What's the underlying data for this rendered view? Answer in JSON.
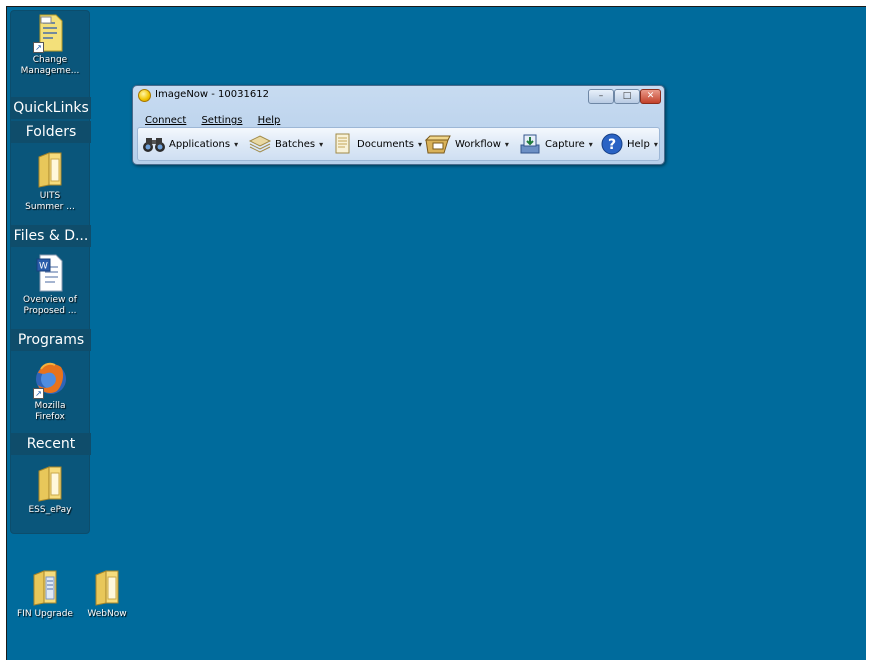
{
  "desktop": {
    "background_color": "#006b9c",
    "sidebar_sections": {
      "quicklinks": "QuickLinks",
      "folders": "Folders",
      "files": "Files & D...",
      "programs": "Programs",
      "recent": "Recent"
    },
    "sidebar_icons": [
      {
        "label_line1": "Change",
        "label_line2": "Manageme...",
        "icon": "document-shortcut-icon"
      },
      {
        "label_line1": "UITS",
        "label_line2": "Summer ...",
        "icon": "folder-icon"
      },
      {
        "label_line1": "Overview of",
        "label_line2": "Proposed ...",
        "icon": "word-document-icon"
      },
      {
        "label_line1": "Mozilla",
        "label_line2": "Firefox",
        "icon": "firefox-icon"
      },
      {
        "label_line1": "ESS_ePay",
        "label_line2": "",
        "icon": "folder-icon"
      }
    ],
    "bottom_icons": [
      {
        "label": "FIN Upgrade",
        "icon": "folder-icon"
      },
      {
        "label": "WebNow",
        "icon": "folder-icon"
      }
    ]
  },
  "window": {
    "title": "ImageNow - 10031612",
    "menu": [
      "Connect",
      "Settings",
      "Help"
    ],
    "toolbar": [
      {
        "label": "Applications",
        "icon": "binoculars-icon"
      },
      {
        "label": "Batches",
        "icon": "batches-icon"
      },
      {
        "label": "Documents",
        "icon": "documents-icon"
      },
      {
        "label": "Workflow",
        "icon": "workflow-icon"
      },
      {
        "label": "Capture",
        "icon": "capture-icon"
      },
      {
        "label": "Help",
        "icon": "help-icon"
      }
    ],
    "dropdown_arrow": "▾",
    "controls": {
      "minimize": "–",
      "maximize": "□",
      "close": "✕"
    }
  }
}
